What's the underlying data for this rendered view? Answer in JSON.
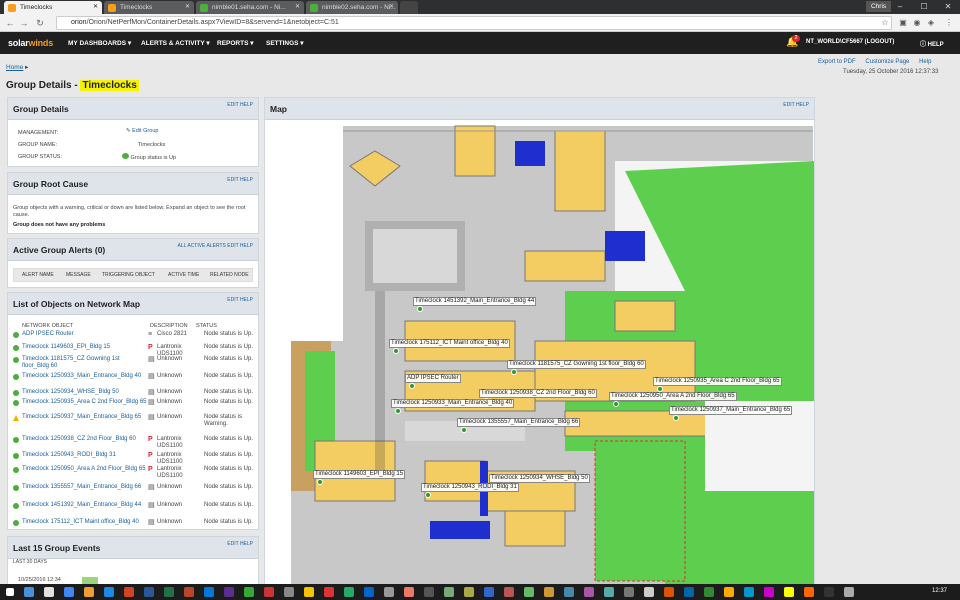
{
  "browser": {
    "tabs": [
      {
        "label": "Timeclocks",
        "active": true,
        "color": "#f99d1c"
      },
      {
        "label": "Timeclocks",
        "active": false,
        "color": "#f99d1c"
      },
      {
        "label": "nimble01.seha.com - Ni...",
        "active": false,
        "color": "#4cae3c"
      },
      {
        "label": "nimble02.seha.com - Ni...",
        "active": false,
        "color": "#4cae3c"
      }
    ],
    "user": "Chris",
    "url_host": "orion",
    "url_path": "/Orion/NetPerfMon/ContainerDetails.aspx?ViewID=8&servend=1&netobject=C:51"
  },
  "app": {
    "logo_a": "solar",
    "logo_b": "winds",
    "menu": [
      "MY DASHBOARDS ▾",
      "ALERTS & ACTIVITY ▾",
      "REPORTS ▾",
      "SETTINGS ▾"
    ],
    "alert_count": "2",
    "user": "NT_WORLD\\CF5667 (LOGOUT)",
    "help": "HELP"
  },
  "breadcrumb": {
    "home": "Home",
    "sep": "▸"
  },
  "page": {
    "title_prefix": "Group Details -",
    "title_highlight": "Timeclocks",
    "export": "Export to PDF",
    "customize": "Customize Page",
    "help": "Help",
    "datetime": "Tuesday, 25 October 2016 12:37:33"
  },
  "group_details": {
    "title": "Group Details",
    "actions": "EDIT  HELP",
    "management_label": "MANAGEMENT:",
    "management_value": "Edit Group",
    "name_label": "GROUP NAME:",
    "name_value": "Timeclocks",
    "status_label": "GROUP STATUS:",
    "status_value": "Group status is Up"
  },
  "root_cause": {
    "title": "Group Root Cause",
    "actions": "EDIT  HELP",
    "desc": "Group objects with a warning, critical or down are listed below. Expand an object to see the root cause.",
    "note": "Group does not have any problems"
  },
  "alerts": {
    "title": "Active Group Alerts (0)",
    "actions": "ALL ACTIVE ALERTS  EDIT  HELP",
    "columns": [
      "ALERT NAME",
      "MESSAGE",
      "TRIGGERING OBJECT",
      "ACTIVE TIME",
      "RELATED NODE"
    ]
  },
  "objects": {
    "title": "List of Objects on Network Map",
    "actions": "EDIT  HELP",
    "columns": [
      "NETWORK OBJECT",
      "DESCRIPTION",
      "STATUS"
    ],
    "rows": [
      {
        "name": "ADP IPSEC Router",
        "desc": "Cisco 2821",
        "status": "Node status is Up.",
        "state": "up",
        "icon": "cisco"
      },
      {
        "name": "Timeclock 1149603_EPI_Bldg 15",
        "desc": "Lantronix UDS1100",
        "status": "Node status is Up.",
        "state": "up",
        "icon": "lantronix"
      },
      {
        "name": "Timeclock 1181575_CZ Gowning 1st floor_Bldg 60",
        "desc": "Unknown",
        "status": "Node status is Up.",
        "state": "up",
        "icon": "unknown"
      },
      {
        "name": "Timeclock 1250933_Main_Entrance_Bldg 40",
        "desc": "Unknown",
        "status": "Node status is Up.",
        "state": "up",
        "icon": "unknown"
      },
      {
        "name": "Timeclock 1250934_WHSE_Bldg 50",
        "desc": "Unknown",
        "status": "Node status is Up.",
        "state": "up",
        "icon": "unknown"
      },
      {
        "name": "Timeclock 1250935_Area C 2nd Floor_Bldg 65",
        "desc": "Unknown",
        "status": "Node status is Up.",
        "state": "up",
        "icon": "unknown"
      },
      {
        "name": "Timeclock 1250937_Main_Entrance_Bldg 65",
        "desc": "Unknown",
        "status": "Node status is Warning.",
        "state": "warn",
        "icon": "unknown"
      },
      {
        "name": "Timeclock 1250938_CZ 2nd Floor_Bldg 60",
        "desc": "Lantronix UDS1100",
        "status": "Node status is Up.",
        "state": "up",
        "icon": "lantronix"
      },
      {
        "name": "Timeclock 1250943_RODI_Bldg 31",
        "desc": "Lantronix UDS1100",
        "status": "Node status is Up.",
        "state": "up",
        "icon": "lantronix"
      },
      {
        "name": "Timeclock 1250950_Area A 2nd Floor_Bldg 65",
        "desc": "Lantronix UDS1100",
        "status": "Node status is Up.",
        "state": "up",
        "icon": "lantronix"
      },
      {
        "name": "Timeclock 1355557_Main_Entrance_Bldg 66",
        "desc": "Unknown",
        "status": "Node status is Up.",
        "state": "up",
        "icon": "unknown"
      },
      {
        "name": "Timeclock 1451392_Main_Entrance_Bldg 44",
        "desc": "Unknown",
        "status": "Node status is Up.",
        "state": "up",
        "icon": "unknown"
      },
      {
        "name": "Timeclock 175112_ICT Maint office_Bldg 40",
        "desc": "Unknown",
        "status": "Node status is Up.",
        "state": "up",
        "icon": "unknown"
      }
    ]
  },
  "events": {
    "title": "Last 15 Group Events",
    "subtitle": "LAST 30 DAYS",
    "actions": "EDIT  HELP",
    "first_date": "10/25/2016 12:34"
  },
  "map": {
    "title": "Map",
    "actions": "EDIT  HELP",
    "labels": [
      "Timeclock 1451392_Main_Entrance_Bldg 44",
      "Timeclock 175112_ICT Maint office_Bldg 40",
      "Timeclock 1181575_CZ Gowning 1st floor_Bldg 60",
      "ADP IPSEC Router",
      "Timeclock 1250935_Area C 2nd Floor_Bldg 65",
      "Timeclock 1250938_CZ 2nd Floor_Bldg 60",
      "Timeclock 1250950_Area A 2nd Floor_Bldg 65",
      "Timeclock 1250933_Main_Entrance_Bldg 40",
      "Timeclock 1250937_Main_Entrance_Bldg 65",
      "Timeclock 1355557_Main_Entrance_Bldg 66",
      "Timeclock 1149603_EPI_Bldg 15",
      "Timeclock 1250934_WHSE_Bldg 50",
      "Timeclock 1250943_RODI_Bldg 31"
    ]
  },
  "taskbar": {
    "time": "12:37"
  }
}
